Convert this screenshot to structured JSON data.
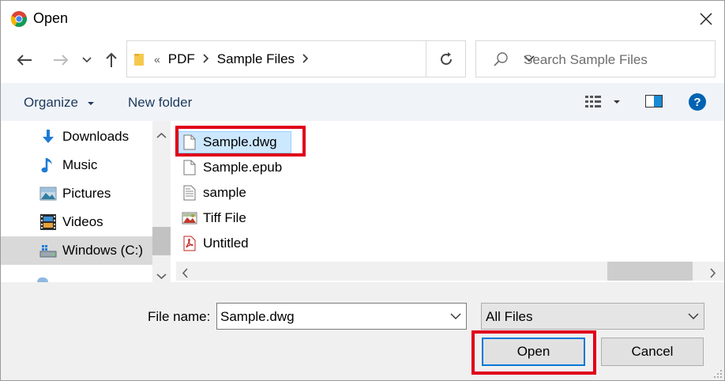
{
  "window": {
    "title": "Open"
  },
  "address": {
    "overflow": "«",
    "crumbs": [
      "PDF",
      "Sample Files"
    ]
  },
  "search": {
    "placeholder": "Search Sample Files"
  },
  "toolbar": {
    "organize": "Organize",
    "new_folder": "New folder"
  },
  "nav": {
    "items": [
      {
        "label": "Downloads",
        "icon": "download-arrow-icon"
      },
      {
        "label": "Music",
        "icon": "music-note-icon"
      },
      {
        "label": "Pictures",
        "icon": "pictures-icon"
      },
      {
        "label": "Videos",
        "icon": "film-strip-icon"
      },
      {
        "label": "Windows (C:)",
        "icon": "drive-icon"
      }
    ],
    "selected": "Windows (C:)"
  },
  "files": [
    {
      "label": "Sample.dwg",
      "icon": "blank-file-icon",
      "selected": true
    },
    {
      "label": "Sample.epub",
      "icon": "blank-file-icon"
    },
    {
      "label": "sample",
      "icon": "text-file-icon"
    },
    {
      "label": "Tiff File",
      "icon": "image-file-icon"
    },
    {
      "label": "Untitled",
      "icon": "pdf-file-icon"
    }
  ],
  "footer": {
    "file_name_label": "File name:",
    "file_name_value": "Sample.dwg",
    "file_type_value": "All Files",
    "open_label": "Open",
    "cancel_label": "Cancel"
  },
  "colors": {
    "highlight": "#e0001b",
    "selection": "#cce8ff",
    "accent": "#0078d7"
  }
}
